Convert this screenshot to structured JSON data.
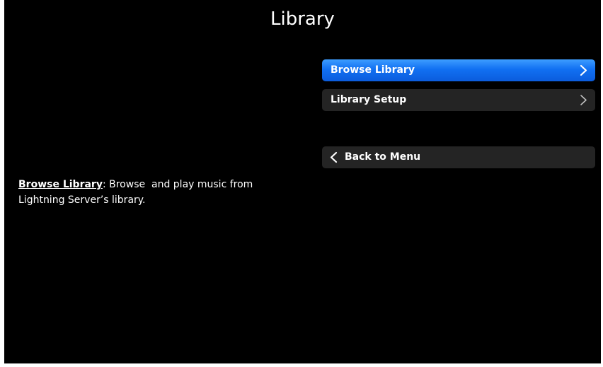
{
  "page": {
    "title": "Library"
  },
  "menu": {
    "items": [
      {
        "label": "Browse Library",
        "selected": true
      },
      {
        "label": "Library Setup",
        "selected": false
      }
    ],
    "back": {
      "label": "Back to Menu"
    }
  },
  "description": {
    "term": "Browse Library",
    "separator": ": ",
    "text": "Browse  and play music from Lightning Server’s library."
  },
  "icons": {
    "item_chevron": "chevron-right-icon",
    "back_chevron": "chevron-left-icon"
  },
  "colors": {
    "background": "#000000",
    "selected_item": "#1170f2",
    "item": "#242424",
    "text": "#ffffff",
    "chevron_inactive": "#bfbfbf"
  }
}
